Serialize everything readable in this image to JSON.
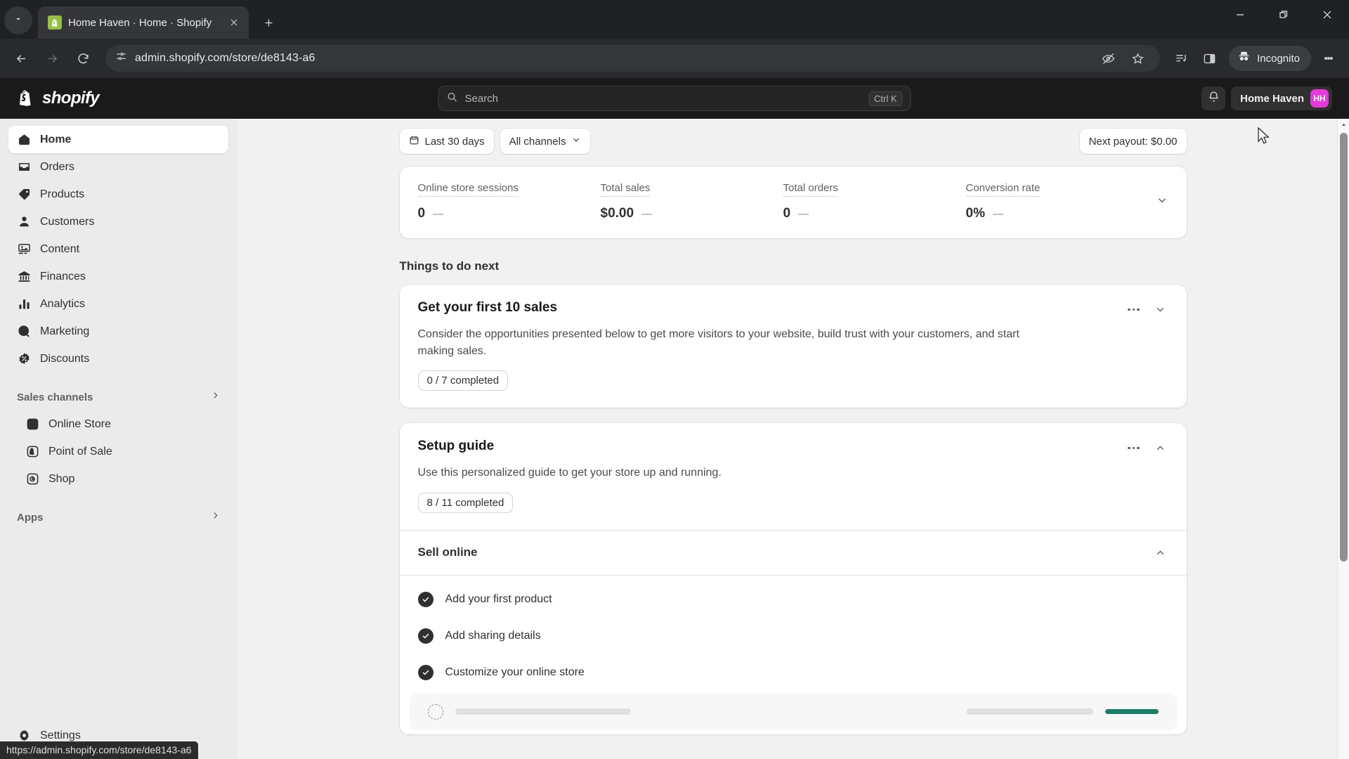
{
  "browser": {
    "tab": {
      "title": "Home Haven · Home · Shopify",
      "favicon_icon": "shopify-bag-icon"
    },
    "newtab_label": "+",
    "tab_list_icon": "chevron-down-icon",
    "nav": {
      "back_icon": "arrow-left-icon",
      "forward_icon": "arrow-right-icon",
      "reload_icon": "reload-icon"
    },
    "omnibox": {
      "site_info_icon": "site-settings-icon",
      "url": "admin.shopify.com/store/de8143-a6"
    },
    "toolbar_icons": [
      "eye-off-icon",
      "star-icon",
      "media-playlist-icon",
      "side-panel-icon"
    ],
    "incognito": {
      "label": "Incognito",
      "icon": "incognito-hat-icon"
    },
    "menu_icon": "kebab-menu-icon",
    "window_controls": {
      "minimize": "minimize-icon",
      "maximize": "restore-icon",
      "close": "close-icon"
    },
    "status_url": "https://admin.shopify.com/store/de8143-a6"
  },
  "shopify_header": {
    "logo_text": "shopify",
    "logo_icon": "shopify-bag-icon",
    "search": {
      "placeholder": "Search",
      "shortcut": "Ctrl K",
      "icon": "search-icon"
    },
    "notifications_icon": "bell-icon",
    "store_name": "Home Haven",
    "store_initials": "HH",
    "avatar_color": "#e838d9"
  },
  "sidebar": {
    "items": [
      {
        "label": "Home",
        "icon": "home-icon",
        "active": true
      },
      {
        "label": "Orders",
        "icon": "orders-inbox-icon",
        "active": false
      },
      {
        "label": "Products",
        "icon": "tag-icon",
        "active": false
      },
      {
        "label": "Customers",
        "icon": "person-icon",
        "active": false
      },
      {
        "label": "Content",
        "icon": "image-icon",
        "active": false
      },
      {
        "label": "Finances",
        "icon": "bank-icon",
        "active": false
      },
      {
        "label": "Analytics",
        "icon": "bar-chart-icon",
        "active": false
      },
      {
        "label": "Marketing",
        "icon": "target-cursor-icon",
        "active": false
      },
      {
        "label": "Discounts",
        "icon": "discount-badge-icon",
        "active": false
      }
    ],
    "sales_channels": {
      "title": "Sales channels",
      "chevron_icon": "chevron-right-icon",
      "items": [
        {
          "label": "Online Store",
          "icon": "storefront-icon"
        },
        {
          "label": "Point of Sale",
          "icon": "pos-icon"
        },
        {
          "label": "Shop",
          "icon": "shop-icon"
        }
      ]
    },
    "apps": {
      "title": "Apps",
      "chevron_icon": "chevron-right-icon"
    },
    "settings": {
      "label": "Settings",
      "icon": "gear-icon"
    }
  },
  "main": {
    "filters": {
      "date_range": {
        "label": "Last 30 days",
        "icon": "calendar-icon"
      },
      "channels": {
        "label": "All channels",
        "icon": "chevron-down-icon"
      },
      "next_payout": {
        "label": "Next payout: $0.00"
      }
    },
    "metrics": {
      "expand_icon": "chevron-down-icon",
      "items": [
        {
          "label": "Online store sessions",
          "value": "0",
          "delta": "—"
        },
        {
          "label": "Total sales",
          "value": "$0.00",
          "delta": "—"
        },
        {
          "label": "Total orders",
          "value": "0",
          "delta": "—"
        },
        {
          "label": "Conversion rate",
          "value": "0%",
          "delta": "—"
        }
      ]
    },
    "things_to_do_title": "Things to do next",
    "first_sales_card": {
      "title": "Get your first 10 sales",
      "description": "Consider the opportunities presented below to get more visitors to your website, build trust with your customers, and start making sales.",
      "badge": "0 / 7 completed",
      "menu_icon": "ellipsis-icon",
      "collapse_icon": "chevron-down-icon"
    },
    "setup_guide_card": {
      "title": "Setup guide",
      "description": "Use this personalized guide to get your store up and running.",
      "badge": "8 / 11 completed",
      "menu_icon": "ellipsis-icon",
      "collapse_icon": "chevron-up-icon",
      "section": {
        "title": "Sell online",
        "collapse_icon": "chevron-up-icon",
        "tasks": [
          {
            "label": "Add your first product",
            "completed": true
          },
          {
            "label": "Add sharing details",
            "completed": true
          },
          {
            "label": "Customize your online store",
            "completed": true
          }
        ]
      }
    }
  }
}
